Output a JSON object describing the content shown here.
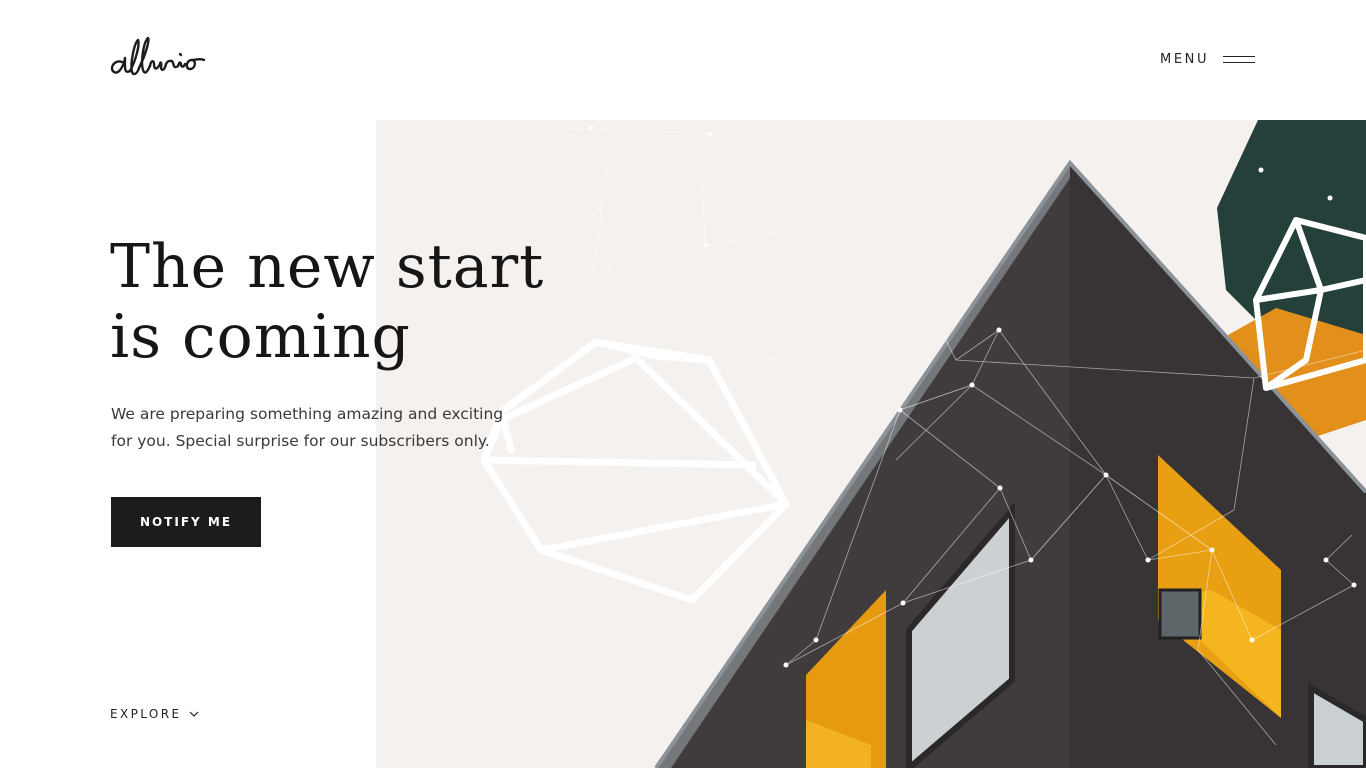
{
  "brand": {
    "logo_text": "allurio",
    "accent": "#e4960f",
    "dark_accent": "#25403b"
  },
  "nav": {
    "menu_label": "MENU",
    "menu_icon": "hamburger-icon"
  },
  "hero": {
    "headline_line1": "The new start",
    "headline_line2": "is coming",
    "subtitle_line1": "We are preparing something amazing and exciting",
    "subtitle_line2": "for you. Special surprise for our subscribers only.",
    "cta_label": "NOTIFY ME"
  },
  "footer": {
    "explore_label": "EXPLORE",
    "explore_icon": "chevron-down-icon"
  }
}
